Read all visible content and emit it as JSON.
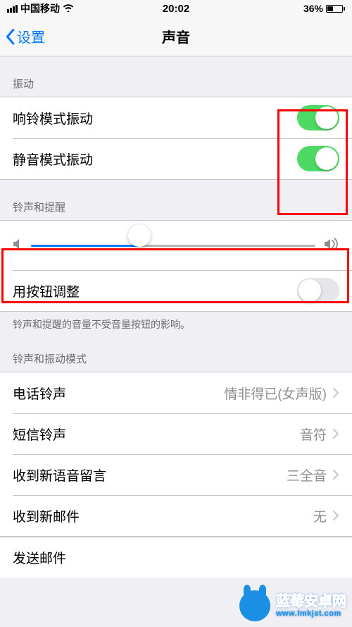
{
  "status": {
    "carrier": "中国移动",
    "time": "20:02",
    "battery_pct": "36%"
  },
  "nav": {
    "back_label": "设置",
    "title": "声音"
  },
  "sections": {
    "vibration_header": "振动",
    "ring_vibrate": {
      "label": "响铃模式振动",
      "on": true
    },
    "silent_vibrate": {
      "label": "静音模式振动",
      "on": true
    },
    "ringer_header": "铃声和提醒",
    "ringer_volume_pct": 38,
    "change_with_buttons": {
      "label": "用按钮调整",
      "on": false
    },
    "volume_footer": "铃声和提醒的音量不受音量按钮的影响。",
    "patterns_header": "铃声和振动模式",
    "ringtone": {
      "label": "电话铃声",
      "value": "情非得已(女声版)"
    },
    "text_tone": {
      "label": "短信铃声",
      "value": "音符"
    },
    "voicemail": {
      "label": "收到新语音留言",
      "value": "三全音"
    },
    "new_mail": {
      "label": "收到新邮件",
      "value": "无"
    },
    "sent_mail": {
      "label": "发送邮件"
    }
  },
  "watermark": {
    "brand": "蓝莓安卓网",
    "url": "www.lmkjst.com"
  }
}
